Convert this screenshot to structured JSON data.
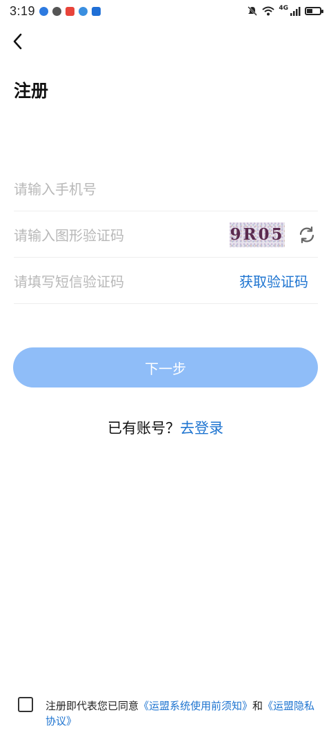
{
  "status_bar": {
    "time": "3:19",
    "network": "4G"
  },
  "header": {
    "title": "注册"
  },
  "form": {
    "phone_placeholder": "请输入手机号",
    "captcha_placeholder": "请输入图形验证码",
    "captcha_text": "9R05",
    "sms_placeholder": "请填写短信验证码",
    "get_code_label": "获取验证码"
  },
  "next_button": {
    "label": "下一步"
  },
  "login": {
    "prompt": "已有账号？",
    "link": "去登录"
  },
  "agreement": {
    "prefix": "注册即代表您已同意",
    "terms_link": "《运盟系统使用前须知》",
    "joiner": "和",
    "privacy_link": "《运盟隐私协议》"
  },
  "colors": {
    "accent": "#1e74d0",
    "button_bg": "#8fbdf8",
    "placeholder": "#b8b8b8"
  }
}
